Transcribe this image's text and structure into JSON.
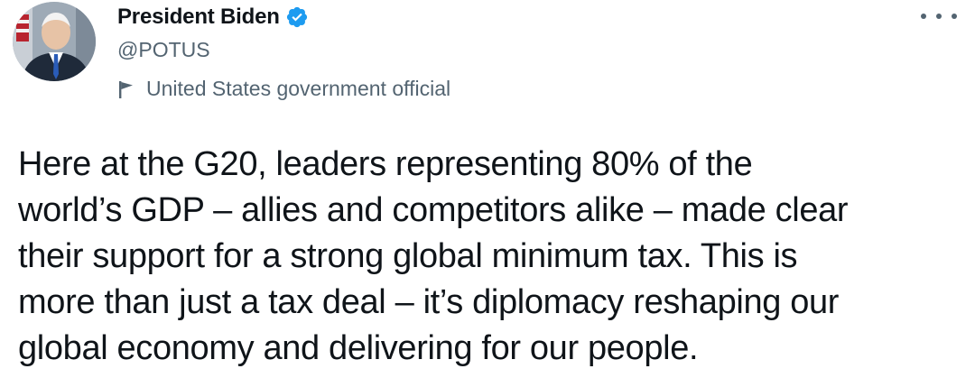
{
  "author": {
    "display_name": "President Biden",
    "handle": "@POTUS",
    "affiliation": "United States government official",
    "verified": true,
    "avatar_icon": "president-portrait-avatar"
  },
  "menu": {
    "more_icon": "more-horizontal-icon"
  },
  "tweet": {
    "lines": [
      "Here at the G20, leaders representing 80% of the",
      "world’s GDP – allies and competitors alike – made clear",
      "their support for a strong global minimum tax. This is",
      "more than just a tax deal – it’s diplomacy reshaping our",
      "global economy and delivering for our people."
    ]
  },
  "colors": {
    "text_primary": "#0f1419",
    "text_secondary": "#536471",
    "verified_badge": "#1d9bf0",
    "background": "#ffffff"
  }
}
